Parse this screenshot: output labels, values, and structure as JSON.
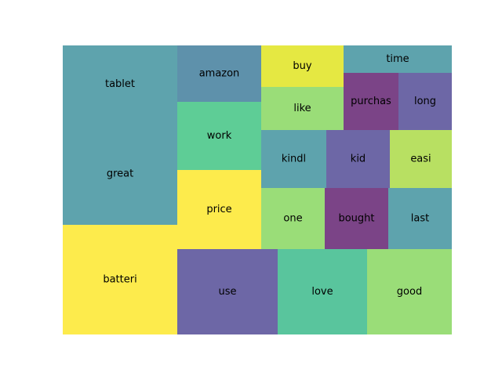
{
  "chart_data": {
    "type": "treemap",
    "title": "",
    "xlabel": "",
    "ylabel": "",
    "axes_visible": false,
    "xlim": [
      0,
      100
    ],
    "ylim": [
      0,
      100
    ],
    "items": [
      {
        "label": "batteri",
        "value": 48,
        "color": "#fde725"
      },
      {
        "label": "great",
        "value": 38,
        "color": "#3b8f9b"
      },
      {
        "label": "tablet",
        "value": 29,
        "color": "#3b8f9b"
      },
      {
        "label": "use",
        "value": 34,
        "color": "#4d4592"
      },
      {
        "label": "love",
        "value": 27,
        "color": "#35b888"
      },
      {
        "label": "good",
        "value": 26,
        "color": "#84d55a"
      },
      {
        "label": "price",
        "value": 22,
        "color": "#fde725"
      },
      {
        "label": "work",
        "value": 18,
        "color": "#3bc27f"
      },
      {
        "label": "amazon",
        "value": 15,
        "color": "#3b7999"
      },
      {
        "label": "one",
        "value": 12,
        "color": "#84d55a"
      },
      {
        "label": "kindl",
        "value": 11,
        "color": "#3b8f9b"
      },
      {
        "label": "like",
        "value": 8.5,
        "color": "#84d55a"
      },
      {
        "label": "buy",
        "value": 8,
        "color": "#dfe318"
      },
      {
        "label": "bought",
        "value": 10,
        "color": "#5e1b6c"
      },
      {
        "label": "last",
        "value": 9.3,
        "color": "#3b8f9b"
      },
      {
        "label": "kid",
        "value": 9.2,
        "color": "#4d4592"
      },
      {
        "label": "easi",
        "value": 9,
        "color": "#a8d940"
      },
      {
        "label": "purchas",
        "value": 6.3,
        "color": "#5e1b6c"
      },
      {
        "label": "long",
        "value": 6.3,
        "color": "#4d4592"
      },
      {
        "label": "time",
        "value": 4.4,
        "color": "#3b8f9b"
      }
    ]
  }
}
